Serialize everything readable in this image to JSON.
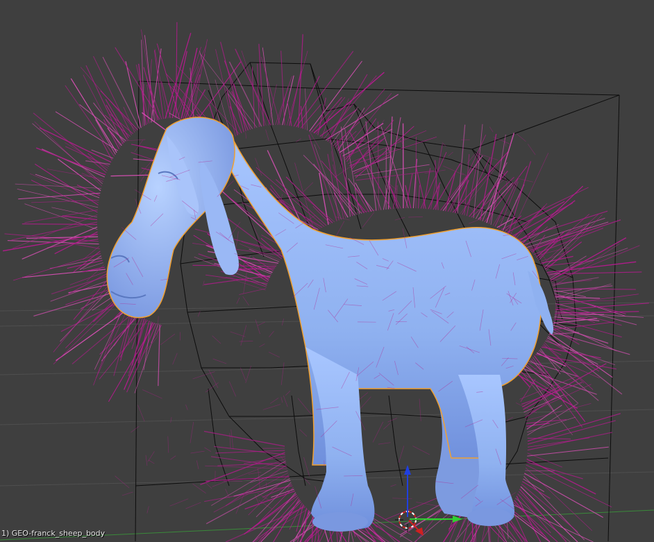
{
  "viewport": {
    "object_label": "1) GEO-franck_sheep_body"
  },
  "colors": {
    "background": "#3f3f3f",
    "grid_line": "#4f4f4f",
    "mesh_fill": "#8fb1f0",
    "mesh_shade": "#5f7fd0",
    "hair": "#b21c8c",
    "hair_light": "#d24fb0",
    "wireframe": "#0a0a0a",
    "selection_outline": "#f0a030",
    "axis_x": "#d02020",
    "axis_y": "#30d030",
    "axis_z": "#2040e0"
  },
  "icons": {
    "cursor": "3d-cursor-icon",
    "gizmo": "transform-gizmo-icon"
  }
}
